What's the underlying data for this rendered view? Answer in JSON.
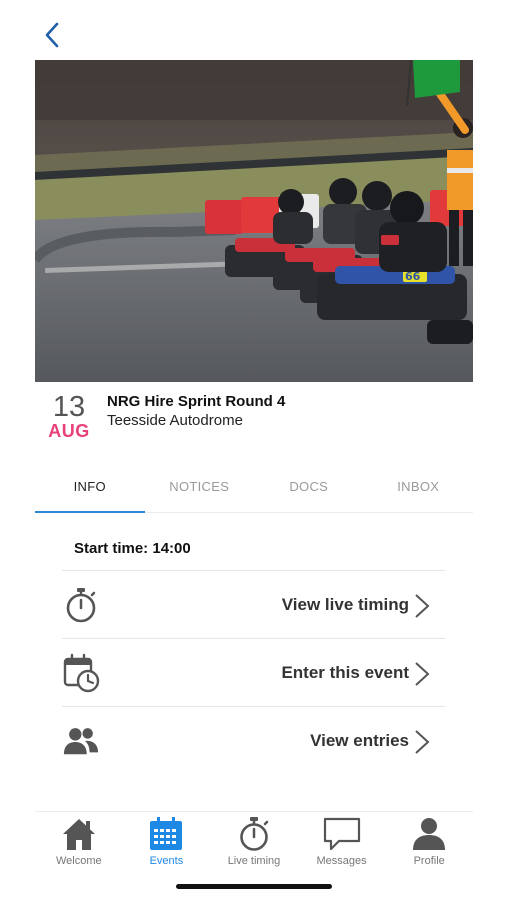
{
  "header": {
    "back_icon": "chevron-left-icon"
  },
  "event": {
    "day": "13",
    "month": "AUG",
    "title": "NRG Hire Sprint Round 4",
    "venue": "Teesside Autodrome",
    "kart_number": "66"
  },
  "tabs": [
    {
      "label": "INFO",
      "active": true
    },
    {
      "label": "NOTICES",
      "active": false
    },
    {
      "label": "DOCS",
      "active": false
    },
    {
      "label": "INBOX",
      "active": false
    }
  ],
  "info": {
    "start_time": "Start time: 14:00",
    "actions": [
      {
        "label": "View live timing",
        "icon": "stopwatch-icon"
      },
      {
        "label": "Enter this event",
        "icon": "calendar-clock-icon"
      },
      {
        "label": "View entries",
        "icon": "people-icon"
      }
    ]
  },
  "tabbar": {
    "items": [
      {
        "label": "Welcome",
        "icon": "home-icon",
        "active": false
      },
      {
        "label": "Events",
        "icon": "calendar-icon",
        "active": true
      },
      {
        "label": "Live timing",
        "icon": "stopwatch-icon",
        "active": false
      },
      {
        "label": "Messages",
        "icon": "chat-bubble-icon",
        "active": false
      },
      {
        "label": "Profile",
        "icon": "person-icon",
        "active": false
      }
    ]
  },
  "colors": {
    "accent": "#1e88e5",
    "tab_underline": "#2b8ad8",
    "month": "#e8417a",
    "back": "#1f5fa8",
    "icon": "#555555"
  }
}
